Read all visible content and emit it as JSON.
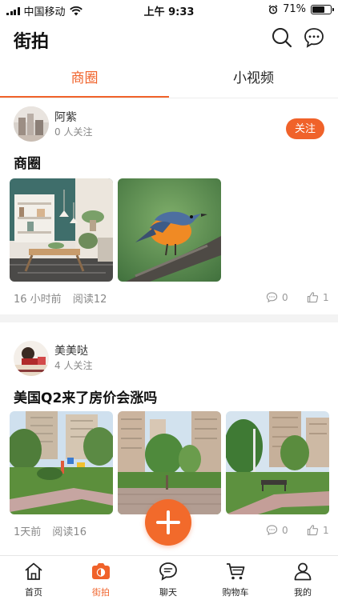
{
  "status_bar": {
    "carrier": "中国移动",
    "time": "上午 9:33",
    "battery": "71%",
    "battery_level": 0.71
  },
  "header": {
    "title": "街拍"
  },
  "tabs": [
    {
      "label": "商圈",
      "active": true
    },
    {
      "label": "小视频",
      "active": false
    }
  ],
  "posts": [
    {
      "username": "阿紫",
      "followers": "0 人关注",
      "follow_label": "关注",
      "title": "商圈",
      "time": "16 小时前",
      "reads": "阅读12",
      "comments": "0",
      "likes": "1"
    },
    {
      "username": "美美哒",
      "followers": "4 人关注",
      "title": "美国Q2来了房价会涨吗",
      "time": "1天前",
      "reads": "阅读16",
      "comments": "0",
      "likes": "1"
    }
  ],
  "bottom_nav": [
    {
      "label": "首页",
      "icon": "home-icon",
      "active": false
    },
    {
      "label": "街拍",
      "icon": "camera-icon",
      "active": true
    },
    {
      "label": "聊天",
      "icon": "chat-icon",
      "active": false
    },
    {
      "label": "购物车",
      "icon": "cart-icon",
      "active": false
    },
    {
      "label": "我的",
      "icon": "profile-icon",
      "active": false
    }
  ],
  "colors": {
    "accent": "#f0622a"
  }
}
